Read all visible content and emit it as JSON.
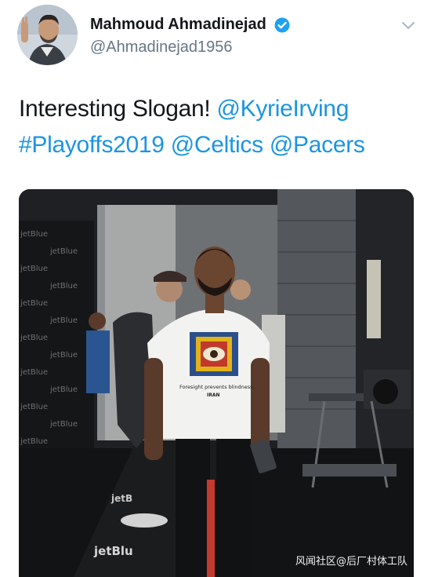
{
  "author": {
    "display_name": "Mahmoud Ahmadinejad",
    "handle": "@Ahmadinejad1956"
  },
  "tweet": {
    "text": "Interesting Slogan!",
    "mention_1": "@KyrieIrving",
    "hashtag": "#Playoffs2019",
    "mention_2": "@Celtics",
    "mention_3": "@Pacers"
  },
  "photo": {
    "shirt_text_top": "Foresight prevents blindness",
    "shirt_text_bottom": "IRAN",
    "floor_logo_text": "jetBlu",
    "floor_logo_text_2": "jetB",
    "backdrop_logo_text": "jetBlue"
  },
  "watermark": "风闻社区@后厂村体工队",
  "colors": {
    "link": "#1b95e0",
    "verified": "#1da1f2"
  },
  "icons": {
    "verified": "verified-badge-icon",
    "caret": "chevron-down-icon"
  }
}
